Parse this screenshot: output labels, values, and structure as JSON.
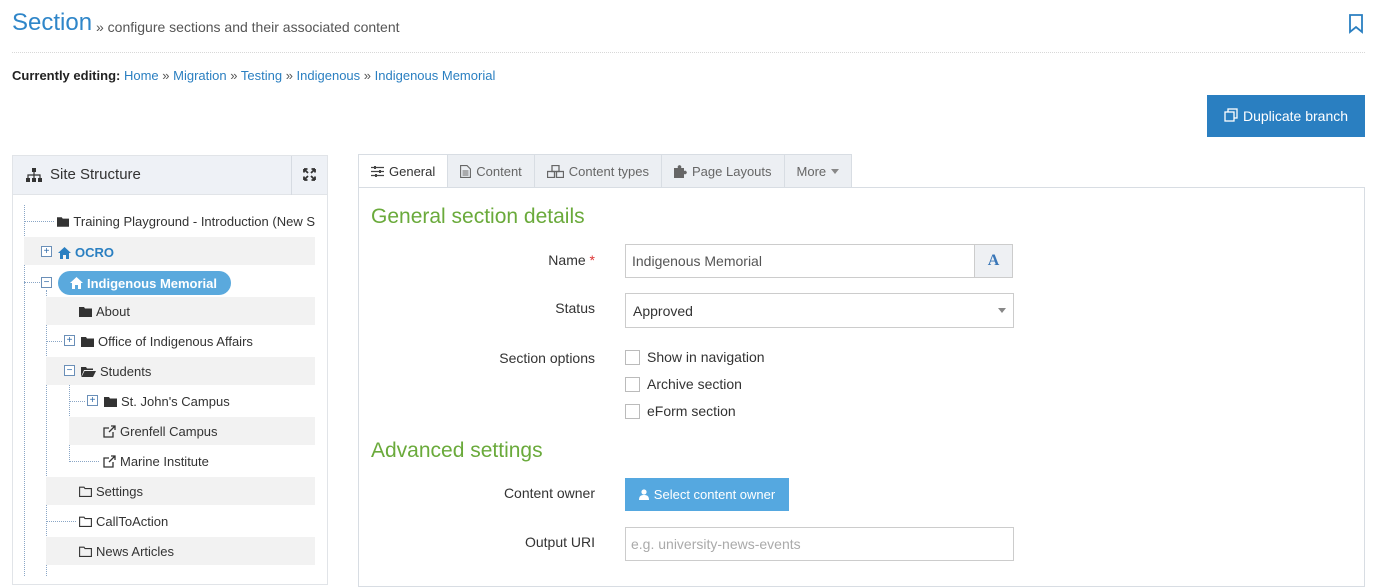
{
  "header": {
    "title": "Section",
    "subtitle": "» configure sections and their associated content"
  },
  "breadcrumb": {
    "label": "Currently editing:",
    "items": [
      "Home",
      "Migration",
      "Testing",
      "Indigenous",
      "Indigenous Memorial"
    ],
    "separator": "»"
  },
  "actions": {
    "duplicate_label": "Duplicate branch"
  },
  "site_structure": {
    "title": "Site Structure",
    "items": [
      {
        "label": "Training Playground - Introduction (New S",
        "icon": "folder-icon"
      },
      {
        "label": "OCRO",
        "icon": "home-icon",
        "toggle": "+"
      },
      {
        "label": "Indigenous Memorial",
        "icon": "home-icon",
        "toggle": "−",
        "selected": true
      },
      {
        "label": "About",
        "icon": "folder-icon"
      },
      {
        "label": "Office of Indigenous Affairs",
        "icon": "folder-icon",
        "toggle": "+"
      },
      {
        "label": "Students",
        "icon": "folder-open-icon",
        "toggle": "−"
      },
      {
        "label": "St. John's Campus",
        "icon": "folder-icon",
        "toggle": "+"
      },
      {
        "label": "Grenfell Campus",
        "icon": "external-link-icon"
      },
      {
        "label": "Marine Institute",
        "icon": "external-link-icon"
      },
      {
        "label": "Settings",
        "icon": "folder-outline-icon"
      },
      {
        "label": "CallToAction",
        "icon": "folder-outline-icon"
      },
      {
        "label": "News Articles",
        "icon": "folder-outline-icon"
      }
    ]
  },
  "tabs": [
    {
      "label": "General",
      "icon": "sliders-icon",
      "active": true
    },
    {
      "label": "Content",
      "icon": "document-icon"
    },
    {
      "label": "Content types",
      "icon": "cubes-icon"
    },
    {
      "label": "Page Layouts",
      "icon": "puzzle-icon"
    },
    {
      "label": "More",
      "icon": "caret-down-icon"
    }
  ],
  "general": {
    "heading": "General section details",
    "name_label": "Name",
    "required_mark": "*",
    "name_value": "Indigenous Memorial",
    "font_button": "A",
    "status_label": "Status",
    "status_value": "Approved",
    "options_label": "Section options",
    "options": [
      "Show in navigation",
      "Archive section",
      "eForm section"
    ]
  },
  "advanced": {
    "heading": "Advanced settings",
    "owner_label": "Content owner",
    "owner_button": "Select content owner",
    "uri_label": "Output URI",
    "uri_placeholder": "e.g. university-news-events"
  },
  "colors": {
    "accent": "#2a7fc1",
    "heading_green": "#6aaa3b",
    "selected_pill": "#5aa9dd"
  }
}
